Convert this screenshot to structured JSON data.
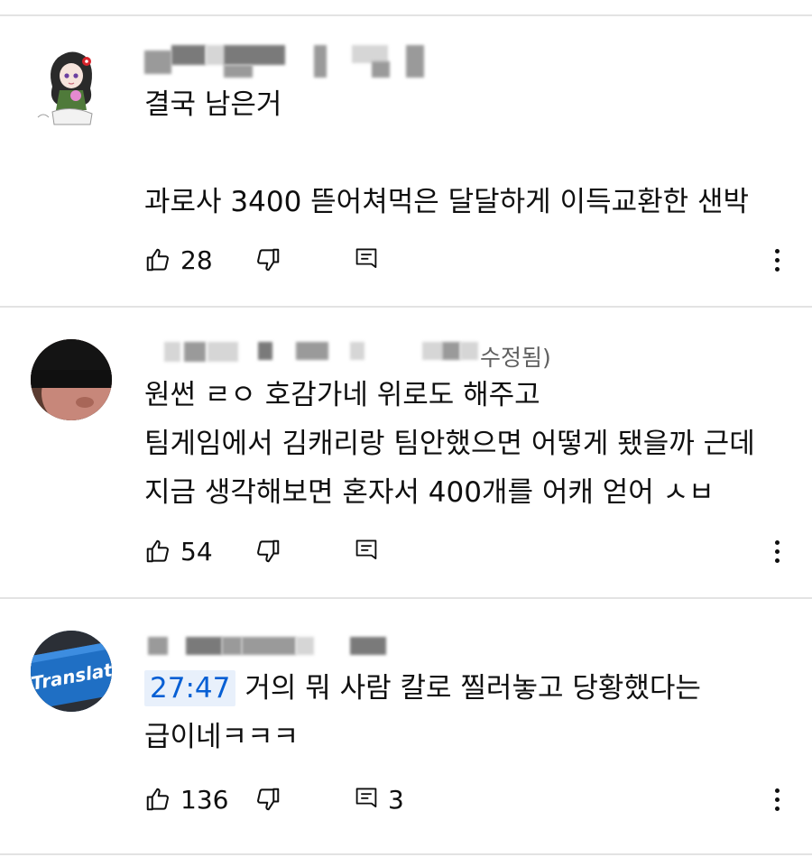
{
  "comments": [
    {
      "body": "결국 남은거\n\n과로사 3400 뜯어쳐먹은 달달하게 이득교환한 샌박",
      "likes": "28",
      "avatar": "anime-girl-avatar",
      "replies": ""
    },
    {
      "edited_label": "수정됨)",
      "body": "원썬 ㄹㅇ 호감가네 위로도 해주고\n팀게임에서 김캐리랑 팀안했으면 어떻게 됐을까 근데\n지금 생각해보면 혼자서 400개를 어캐 얻어 ㅅㅂ",
      "likes": "54",
      "avatar": "masked-face-avatar",
      "replies": ""
    },
    {
      "timestamp": "27:47",
      "body_after_timestamp": "거의 뭐 사람 칼로 찔러놓고 당황했다는\n급이네ㅋㅋㅋ",
      "likes": "136",
      "replies": "3",
      "avatar": "translate-key-avatar"
    }
  ],
  "icons": {
    "like": "thumbs-up-icon",
    "dislike": "thumbs-down-icon",
    "reply": "reply-icon",
    "more": "more-vertical-icon"
  },
  "colors": {
    "timestamp_bg": "#e8f0fb",
    "timestamp_text": "#065fd4",
    "divider": "#e3e3e3"
  }
}
